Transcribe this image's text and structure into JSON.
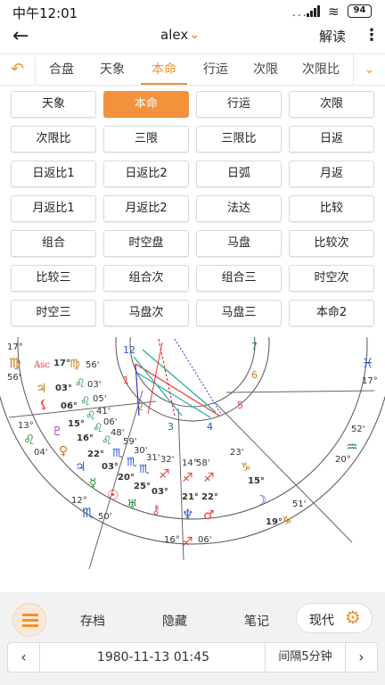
{
  "status": {
    "time": "中午12:01",
    "signal_text": "...",
    "battery": "94"
  },
  "appbar": {
    "user": "alex",
    "interpret": "解读"
  },
  "tabs": [
    {
      "label": "合盘"
    },
    {
      "label": "天象"
    },
    {
      "label": "本命",
      "active": true
    },
    {
      "label": "行运"
    },
    {
      "label": "次限"
    },
    {
      "label": "次限比"
    }
  ],
  "grid": [
    "天象",
    "本命",
    "行运",
    "次限",
    "次限比",
    "三限",
    "三限比",
    "日返",
    "日返比1",
    "日返比2",
    "日弧",
    "月返",
    "月返比1",
    "月返比2",
    "法达",
    "比较",
    "组合",
    "时空盘",
    "马盘",
    "比较次",
    "比较三",
    "组合次",
    "组合三",
    "时空次",
    "时空三",
    "马盘次",
    "马盘三",
    "本命2"
  ],
  "grid_active_index": 1,
  "chart": {
    "houses": [
      "12",
      "1",
      "2",
      "3",
      "4",
      "5",
      "6",
      "7"
    ],
    "degrees": [
      {
        "t": "17°"
      },
      {
        "t": "17°"
      },
      {
        "t": "56'"
      },
      {
        "t": "56'"
      },
      {
        "t": "03°"
      },
      {
        "t": "03'"
      },
      {
        "t": "06°"
      },
      {
        "t": "05'"
      },
      {
        "t": "41'"
      },
      {
        "t": "06'"
      },
      {
        "t": "15°"
      },
      {
        "t": "48'"
      },
      {
        "t": "16°"
      },
      {
        "t": "59'"
      },
      {
        "t": "13°"
      },
      {
        "t": "04'"
      },
      {
        "t": "22°"
      },
      {
        "t": "30'"
      },
      {
        "t": "31'"
      },
      {
        "t": "03°"
      },
      {
        "t": "32'"
      },
      {
        "t": "20°"
      },
      {
        "t": "25°"
      },
      {
        "t": "03°"
      },
      {
        "t": "14°"
      },
      {
        "t": "58'"
      },
      {
        "t": "23'"
      },
      {
        "t": "15°"
      },
      {
        "t": "21°"
      },
      {
        "t": "22°"
      },
      {
        "t": "12°"
      },
      {
        "t": "50'"
      },
      {
        "t": "51'"
      },
      {
        "t": "19°"
      },
      {
        "t": "16°"
      },
      {
        "t": "06'"
      },
      {
        "t": "52'"
      },
      {
        "t": "20°"
      },
      {
        "t": "17°"
      }
    ],
    "asc_label": "Asc"
  },
  "bottom": {
    "archive": "存档",
    "hide": "隐藏",
    "notes": "笔记",
    "mode": "现代",
    "date": "1980-11-13 01:45",
    "interval": "间隔5分钟"
  }
}
